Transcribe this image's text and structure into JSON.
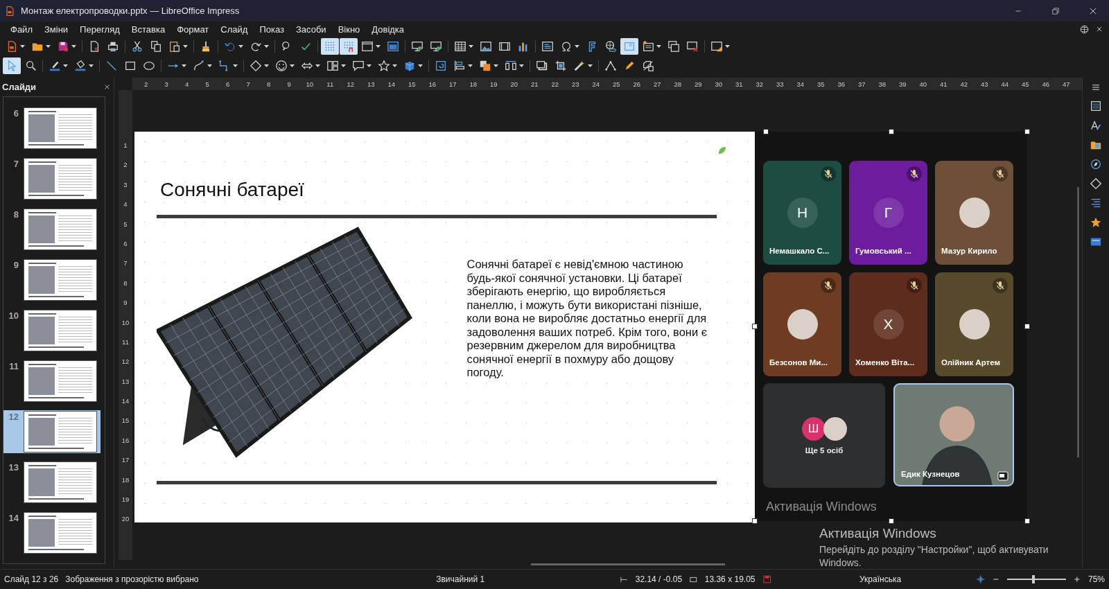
{
  "window": {
    "title": "Монтаж електропроводки.pptx — LibreOffice Impress"
  },
  "menu": [
    "Файл",
    "Зміни",
    "Перегляд",
    "Вставка",
    "Формат",
    "Слайд",
    "Показ",
    "Засоби",
    "Вікно",
    "Довідка"
  ],
  "toolbars": {
    "show_grid_on": true,
    "snap_to_grid_on": true,
    "image_map_on": true,
    "select_on": true
  },
  "slides_panel": {
    "title": "Слайди",
    "thumbnails": [
      {
        "number": "6",
        "selected": false
      },
      {
        "number": "7",
        "selected": false
      },
      {
        "number": "8",
        "selected": false
      },
      {
        "number": "9",
        "selected": false
      },
      {
        "number": "10",
        "selected": false
      },
      {
        "number": "11",
        "selected": false
      },
      {
        "number": "12",
        "selected": true
      },
      {
        "number": "13",
        "selected": false
      },
      {
        "number": "14",
        "selected": false
      }
    ]
  },
  "rulers": {
    "horizontal": [
      "2",
      "3",
      "4",
      "5",
      "6",
      "7",
      "8",
      "9",
      "10",
      "11",
      "12",
      "13",
      "14",
      "15",
      "16",
      "17",
      "18",
      "19",
      "20",
      "21",
      "22",
      "23",
      "24",
      "25",
      "26",
      "27",
      "28",
      "29",
      "30",
      "31",
      "32",
      "33",
      "34",
      "35",
      "36",
      "37",
      "38",
      "39",
      "40",
      "41",
      "42",
      "43",
      "44",
      "45",
      "46",
      "47"
    ],
    "vertical": [
      "1",
      "2",
      "3",
      "4",
      "5",
      "6",
      "7",
      "8",
      "9",
      "10",
      "11",
      "12",
      "13",
      "14",
      "15",
      "16",
      "17",
      "18",
      "19",
      "20"
    ]
  },
  "slide": {
    "title": "Сонячні батареї",
    "body": "Сонячні батареї є невід'ємною частиною\nбудь-якої сонячної установки. Ці батареї\nзберігають енергію, що виробляється\nпанеллю, і можуть бути використані пізніше,\nколи вона не виробляє достатньо енергії для\nзадоволення ваших потреб. Крім того, вони є\nрезервним джерелом для виробництва\nсонячної енергії в похмуру або дощову\nпогоду."
  },
  "meeting": {
    "image_selected": true,
    "participants": [
      {
        "name": "Немашкало С...",
        "kind": "letter",
        "initial": "Н",
        "color": "#1d4d42",
        "muted": true
      },
      {
        "name": "Гумовський ...",
        "kind": "letter",
        "initial": "Г",
        "color": "#6c1c9c",
        "muted": true
      },
      {
        "name": "Мазур Кирило",
        "kind": "photo",
        "color": "#6e5038",
        "muted": true
      },
      {
        "name": "Безсонов Ми...",
        "kind": "photo",
        "color": "#6e3c22",
        "muted": true
      },
      {
        "name": "Хоменко Віта...",
        "kind": "letter",
        "initial": "Х",
        "color": "#5e2c1c",
        "muted": true
      },
      {
        "name": "Олійник Артем",
        "kind": "photo",
        "color": "#5a4a2c",
        "muted": true
      }
    ],
    "more": {
      "initial": "Ш",
      "label": "Ще 5 осіб"
    },
    "speaker": {
      "name": "Едик Кузнецов",
      "selected": true
    },
    "watermark": "Активація Windows"
  },
  "activation": {
    "title": "Активація Windows",
    "message": "Перейдіть до розділу \"Настройки\", щоб активувати Windows."
  },
  "status_bar": {
    "slide": "Слайд 12 з 26",
    "selection": "Зображення з прозорістю вибрано",
    "layout": "Звичайний 1",
    "position": "32.14 / -0.05",
    "size": "13.36 x 19.05",
    "language": "Українська",
    "zoom_slider": {
      "level": 0.45
    },
    "zoom": "75%"
  }
}
